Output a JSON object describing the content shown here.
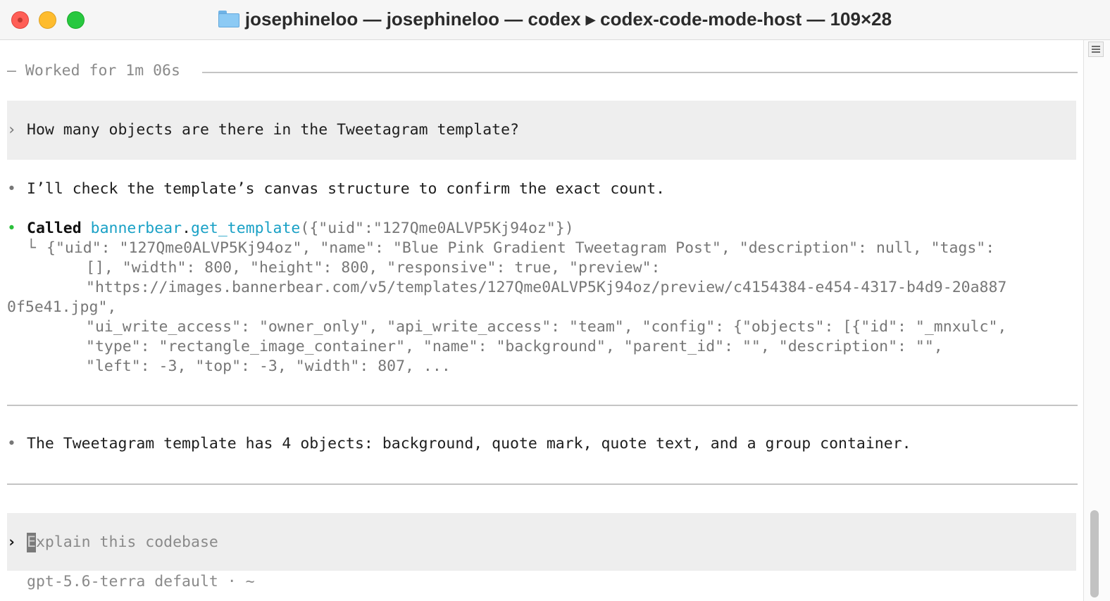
{
  "window": {
    "title": "josephineloo — josephineloo — codex ▸ codex-code-mode-host — 109×28"
  },
  "terminal": {
    "status_line": "— Worked for 1m 06s",
    "user_prompt": {
      "marker": "›",
      "text": "How many objects are there in the Tweetagram template?"
    },
    "assistant_note": {
      "bullet": "•",
      "text": "I’ll check the template’s canvas structure to confirm the exact count."
    },
    "tool_call": {
      "bullet": "•",
      "called_label": "Called",
      "namespace": "bannerbear",
      "dot": ".",
      "function": "get_template",
      "args": "({\"uid\":\"127Qme0ALVP5Kj94oz\"})",
      "branch_glyph": "└",
      "output_lines": [
        "{\"uid\": \"127Qme0ALVP5Kj94oz\", \"name\": \"Blue Pink Gradient Tweetagram Post\", \"description\": null, \"tags\":",
        "[], \"width\": 800, \"height\": 800, \"responsive\": true, \"preview\":",
        "\"https://images.bannerbear.com/v5/templates/127Qme0ALVP5Kj94oz/preview/c4154384-e454-4317-b4d9-20a887",
        "0f5e41.jpg\",",
        "\"ui_write_access\": \"owner_only\", \"api_write_access\": \"team\", \"config\": {\"objects\": [{\"id\": \"_mnxulc\",",
        "\"type\": \"rectangle_image_container\", \"name\": \"background\", \"parent_id\": \"\", \"description\": \"\",",
        "\"left\": -3, \"top\": -3, \"width\": 807, ..."
      ]
    },
    "answer": {
      "bullet": "•",
      "text": "The Tweetagram template has 4 objects: background, quote mark, quote text, and a group container."
    },
    "composer": {
      "marker": "›",
      "cursor_char": "E",
      "placeholder_rest": "xplain this codebase"
    },
    "footer": "gpt-5.6-terra default · ~"
  },
  "colors": {
    "accent_cyan": "#1aa1c6",
    "success_green": "#2bbf3b",
    "prompt_bg": "#eeeeee"
  },
  "icons": {
    "title_folder": "folder-icon",
    "scroll_menu": "menu-icon"
  }
}
